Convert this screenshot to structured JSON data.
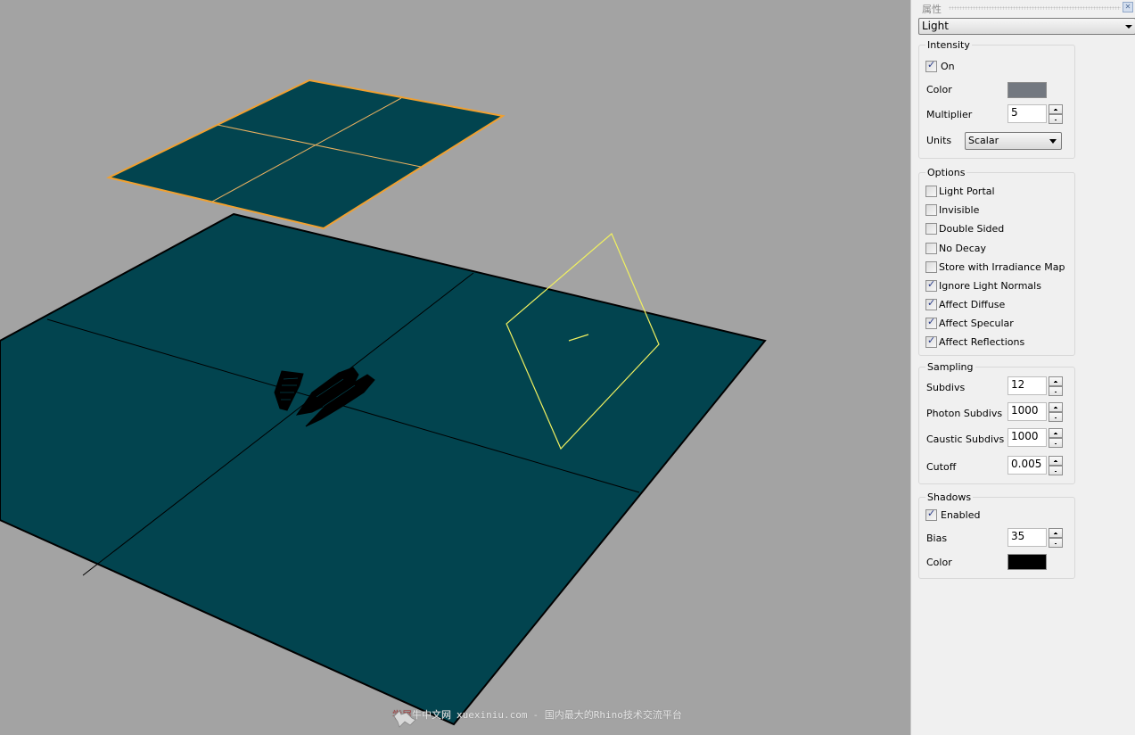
{
  "viewport": {
    "background_color": "#a3a3a3",
    "plane_color": "#02444f",
    "selection_color": "#f0a030",
    "light_color": "#f0f060",
    "objects": {
      "upper_plane": "selected-plane",
      "ground_plane": "ground-plane",
      "model": "wireframe-model",
      "light": "rectangle-light"
    },
    "watermark": {
      "site_name_red": "学犀",
      "site_name_rest": "牛中文网",
      "url": "xuexiniu.com",
      "tagline": "- 国内最大的Rhino技术交流平台"
    }
  },
  "panel": {
    "title": "属性",
    "close_icon": "✕",
    "object_type": "Light",
    "intensity": {
      "title": "Intensity",
      "on_label": "On",
      "on_checked": true,
      "color_label": "Color",
      "color_value": "#737880",
      "multiplier_label": "Multiplier",
      "multiplier_value": "5",
      "units_label": "Units",
      "units_value": "Scalar"
    },
    "options": {
      "title": "Options",
      "items": [
        {
          "label": "Light Portal",
          "checked": false
        },
        {
          "label": "Invisible",
          "checked": false
        },
        {
          "label": "Double Sided",
          "checked": false
        },
        {
          "label": "No Decay",
          "checked": false
        },
        {
          "label": "Store with Irradiance Map",
          "checked": false
        },
        {
          "label": "Ignore Light Normals",
          "checked": true
        },
        {
          "label": "Affect Diffuse",
          "checked": true
        },
        {
          "label": "Affect Specular",
          "checked": true
        },
        {
          "label": "Affect Reflections",
          "checked": true
        }
      ]
    },
    "sampling": {
      "title": "Sampling",
      "subdivs_label": "Subdivs",
      "subdivs_value": "12",
      "photon_subdivs_label": "Photon Subdivs",
      "photon_subdivs_value": "1000",
      "caustic_subdivs_label": "Caustic Subdivs",
      "caustic_subdivs_value": "1000",
      "cutoff_label": "Cutoff",
      "cutoff_value": "0.005"
    },
    "shadows": {
      "title": "Shadows",
      "enabled_label": "Enabled",
      "enabled_checked": true,
      "bias_label": "Bias",
      "bias_value": "35",
      "color_label": "Color",
      "color_value": "#000000"
    }
  }
}
